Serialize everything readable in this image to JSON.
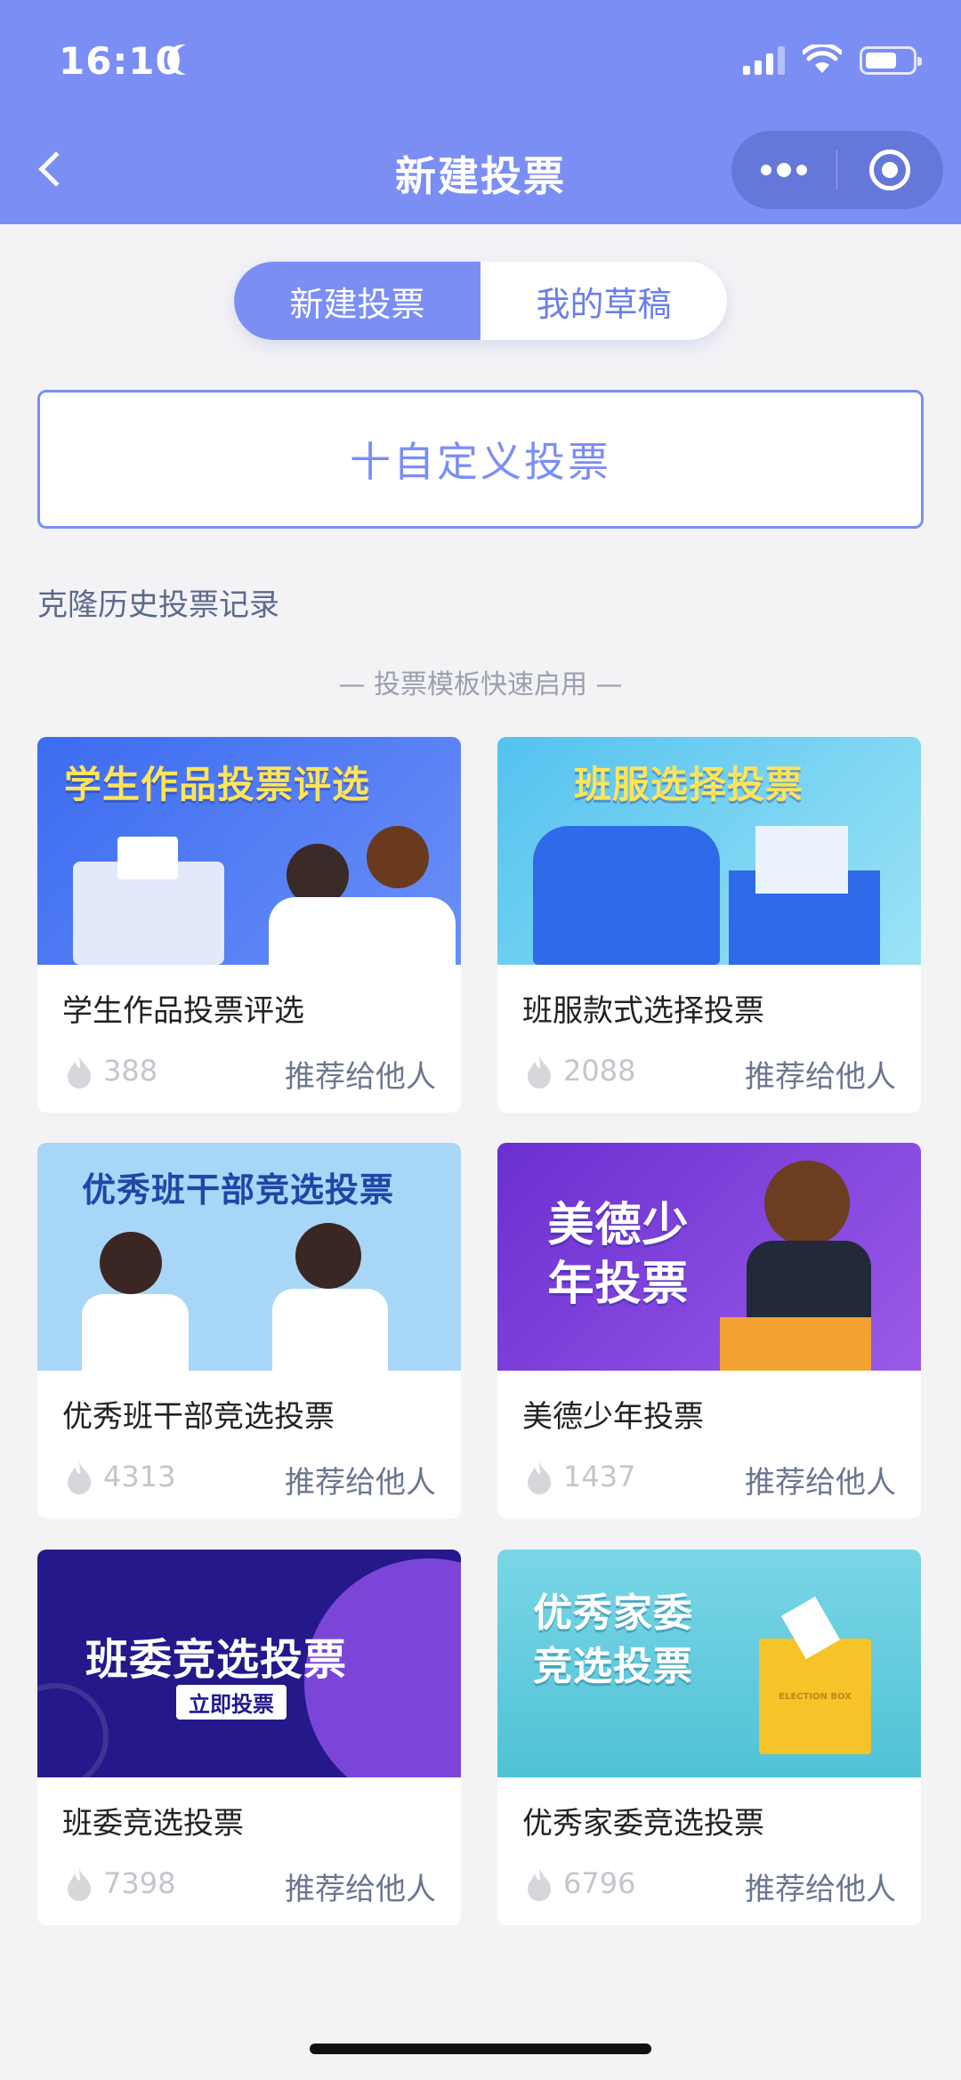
{
  "status": {
    "time": "16:10"
  },
  "nav": {
    "title": "新建投票"
  },
  "tabs": [
    {
      "label": "新建投票",
      "active": true
    },
    {
      "label": "我的草稿",
      "active": false
    }
  ],
  "custom_button": {
    "label": "十自定义投票"
  },
  "clone_link": {
    "label": "克隆历史投票记录"
  },
  "section_title": "— 投票模板快速启用 —",
  "templates": [
    {
      "banner": "学生作品投票评选",
      "name": "学生作品投票评选",
      "count": "388",
      "share": "推荐给他人",
      "bg": "#4a78f5"
    },
    {
      "banner": "班服选择投票",
      "name": "班服款式选择投票",
      "count": "2088",
      "share": "推荐给他人",
      "bg": "#5fc9ee"
    },
    {
      "banner": "优秀班干部竞选投票",
      "name": "优秀班干部竞选投票",
      "count": "4313",
      "share": "推荐给他人",
      "bg": "#a8d6f6"
    },
    {
      "banner": "美德少年投票",
      "name": "美德少年投票",
      "count": "1437",
      "share": "推荐给他人",
      "bg": "#7c3fd8"
    },
    {
      "banner": "班委竞选投票",
      "banner_sub": "立即投票",
      "name": "班委竞选投票",
      "count": "7398",
      "share": "推荐给他人",
      "bg": "#2a1a8a"
    },
    {
      "banner": "优秀家委竞选投票",
      "banner_sub": "ELECTION BOX",
      "name": "优秀家委竞选投票",
      "count": "6796",
      "share": "推荐给他人",
      "bg": "#5ac8dc"
    }
  ],
  "colors": {
    "header": "#7b8ef4",
    "accent": "#7b8ef4",
    "background": "#f3f3f6"
  },
  "icons": {
    "back": "chevron-left-icon",
    "more": "more-dots-icon",
    "close": "target-close-icon",
    "hot": "fire-icon"
  }
}
